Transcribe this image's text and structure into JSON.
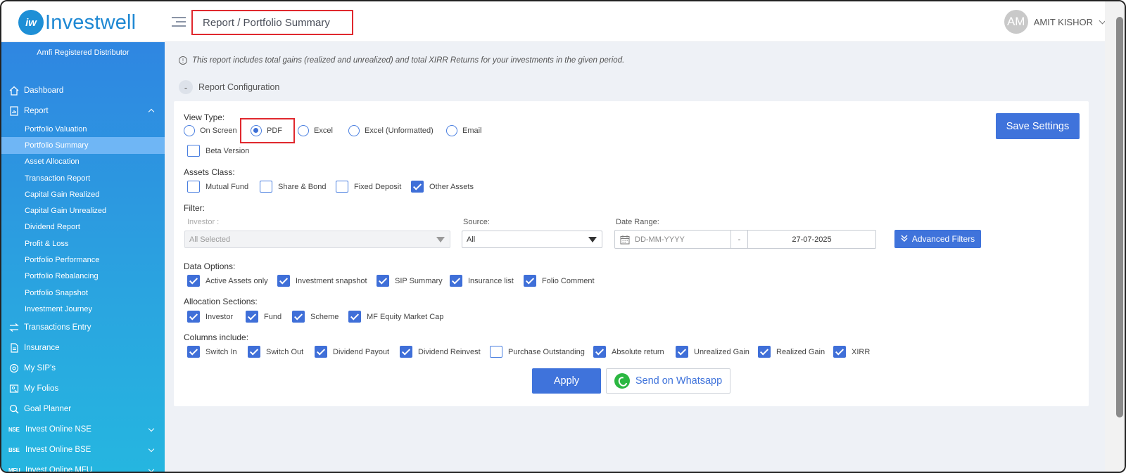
{
  "brand": {
    "logo_mark": "iw",
    "logo_text": "Investwell",
    "distributor": "Amfi Registered Distributor"
  },
  "header": {
    "breadcrumb": "Report / Portfolio Summary"
  },
  "user": {
    "initials": "AM",
    "name": "AMIT KISHOR"
  },
  "sidebar": {
    "items": [
      {
        "label": "Dashboard",
        "icon": "home-icon"
      },
      {
        "label": "Report",
        "icon": "report-icon",
        "expanded": true
      },
      {
        "label": "Transactions Entry",
        "icon": "transfer-icon"
      },
      {
        "label": "Insurance",
        "icon": "document-icon"
      },
      {
        "label": "My SIP's",
        "icon": "sip-icon"
      },
      {
        "label": "My Folios",
        "icon": "folio-icon"
      },
      {
        "label": "Goal Planner",
        "icon": "goal-icon"
      },
      {
        "label": "Invest Online NSE",
        "icon_text": "NSE"
      },
      {
        "label": "Invest Online BSE",
        "icon_text": "BSE"
      },
      {
        "label": "Invest Online MFU",
        "icon_text": "MFU"
      }
    ],
    "report_submenu": [
      "Portfolio Valuation",
      "Portfolio Summary",
      "Asset Allocation",
      "Transaction Report",
      "Capital Gain Realized",
      "Capital Gain Unrealized",
      "Dividend Report",
      "Profit & Loss",
      "Portfolio Performance",
      "Portfolio Rebalancing",
      "Portfolio Snapshot",
      "Investment Journey"
    ],
    "active_submenu": "Portfolio Summary"
  },
  "main": {
    "info_text": "This report includes total gains (realized and unrealized) and total XIRR Returns for your investments in the given period.",
    "config_toggle_symbol": "-",
    "config_title": "Report Configuration",
    "save_settings": "Save Settings",
    "view_type": {
      "label": "View Type:",
      "options": [
        "On Screen",
        "PDF",
        "Excel",
        "Excel (Unformatted)",
        "Email"
      ],
      "selected": "PDF",
      "beta_label": "Beta Version",
      "beta_checked": false
    },
    "assets_class": {
      "label": "Assets Class:",
      "options": [
        {
          "label": "Mutual Fund",
          "checked": false
        },
        {
          "label": "Share & Bond",
          "checked": false
        },
        {
          "label": "Fixed Deposit",
          "checked": false
        },
        {
          "label": "Other Assets",
          "checked": true
        }
      ]
    },
    "filter": {
      "label": "Filter:",
      "investor_label": "Investor :",
      "investor_value": "All Selected",
      "source_label": "Source:",
      "source_value": "All",
      "date_range_label": "Date Range:",
      "date_from_placeholder": "DD-MM-YYYY",
      "date_separator": "-",
      "date_to": "27-07-2025",
      "advanced_filters": "Advanced Filters"
    },
    "data_options": {
      "label": "Data Options:",
      "options": [
        {
          "label": "Active Assets only",
          "checked": true
        },
        {
          "label": "Investment snapshot",
          "checked": true
        },
        {
          "label": "SIP Summary",
          "checked": true
        },
        {
          "label": "Insurance list",
          "checked": true
        },
        {
          "label": "Folio Comment",
          "checked": true
        }
      ]
    },
    "allocation_sections": {
      "label": "Allocation Sections:",
      "options": [
        {
          "label": "Investor",
          "checked": true
        },
        {
          "label": "Fund",
          "checked": true
        },
        {
          "label": "Scheme",
          "checked": true
        },
        {
          "label": "MF Equity Market Cap",
          "checked": true
        }
      ]
    },
    "columns_include": {
      "label": "Columns include:",
      "options": [
        {
          "label": "Switch In",
          "checked": true
        },
        {
          "label": "Switch Out",
          "checked": true
        },
        {
          "label": "Dividend Payout",
          "checked": true
        },
        {
          "label": "Dividend Reinvest",
          "checked": true
        },
        {
          "label": "Purchase Outstanding",
          "checked": false
        },
        {
          "label": "Absolute return",
          "checked": true
        },
        {
          "label": "Unrealized Gain",
          "checked": true
        },
        {
          "label": "Realized Gain",
          "checked": true
        },
        {
          "label": "XIRR",
          "checked": true
        }
      ]
    },
    "apply": "Apply",
    "send_whatsapp": "Send on Whatsapp"
  },
  "colors": {
    "primary": "#3f73db",
    "sidebar_top": "#2f86e1",
    "sidebar_bottom": "#25b6e0",
    "highlight": "#e0282e",
    "whatsapp": "#2bb741"
  }
}
